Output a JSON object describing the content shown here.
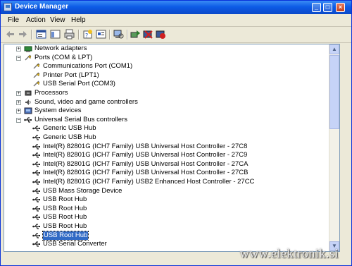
{
  "window": {
    "title": "Device Manager"
  },
  "title_buttons": [
    "_",
    "□",
    "×"
  ],
  "menu": [
    "File",
    "Action",
    "View",
    "Help"
  ],
  "toolbar": {
    "buttons": [
      "back-icon",
      "forward-icon",
      "properties-icon",
      "print-icon",
      "help-icon",
      "view-icon",
      "scan-icon",
      "update-driver-icon",
      "uninstall-icon",
      "disable-icon"
    ]
  },
  "tree": [
    {
      "label": "Network adapters",
      "icon": "network-icon",
      "expander": "+"
    },
    {
      "label": "Ports (COM & LPT)",
      "icon": "port-icon",
      "expander": "-"
    },
    {
      "label": "Communications Port (COM1)",
      "icon": "port-icon"
    },
    {
      "label": "Printer Port (LPT1)",
      "icon": "port-icon"
    },
    {
      "label": "USB Serial Port (COM3)",
      "icon": "port-icon"
    },
    {
      "label": "Processors",
      "icon": "processor-icon",
      "expander": "+"
    },
    {
      "label": "Sound, video and game controllers",
      "icon": "sound-icon",
      "expander": "+"
    },
    {
      "label": "System devices",
      "icon": "system-icon",
      "expander": "+"
    },
    {
      "label": "Universal Serial Bus controllers",
      "icon": "usb-icon",
      "expander": "-"
    },
    {
      "label": "Generic USB Hub",
      "icon": "usb-icon"
    },
    {
      "label": "Generic USB Hub",
      "icon": "usb-icon"
    },
    {
      "label": "Intel(R) 82801G (ICH7 Family) USB Universal Host Controller - 27C8",
      "icon": "usb-icon"
    },
    {
      "label": "Intel(R) 82801G (ICH7 Family) USB Universal Host Controller - 27C9",
      "icon": "usb-icon"
    },
    {
      "label": "Intel(R) 82801G (ICH7 Family) USB Universal Host Controller - 27CA",
      "icon": "usb-icon"
    },
    {
      "label": "Intel(R) 82801G (ICH7 Family) USB Universal Host Controller - 27CB",
      "icon": "usb-icon"
    },
    {
      "label": "Intel(R) 82801G (ICH7 Family) USB2 Enhanced Host Controller - 27CC",
      "icon": "usb-icon"
    },
    {
      "label": "USB Mass Storage Device",
      "icon": "usb-icon"
    },
    {
      "label": "USB Root Hub",
      "icon": "usb-icon"
    },
    {
      "label": "USB Root Hub",
      "icon": "usb-icon"
    },
    {
      "label": "USB Root Hub",
      "icon": "usb-icon"
    },
    {
      "label": "USB Root Hub",
      "icon": "usb-icon"
    },
    {
      "label": "USB Root Hub",
      "icon": "usb-icon",
      "selected": true
    },
    {
      "label": "USB Serial Converter",
      "icon": "usb-icon"
    }
  ],
  "watermark": "www.elektronik.si",
  "colors": {
    "title": "#0a48c9",
    "selection": "#316ac5",
    "face": "#ece9d8"
  }
}
